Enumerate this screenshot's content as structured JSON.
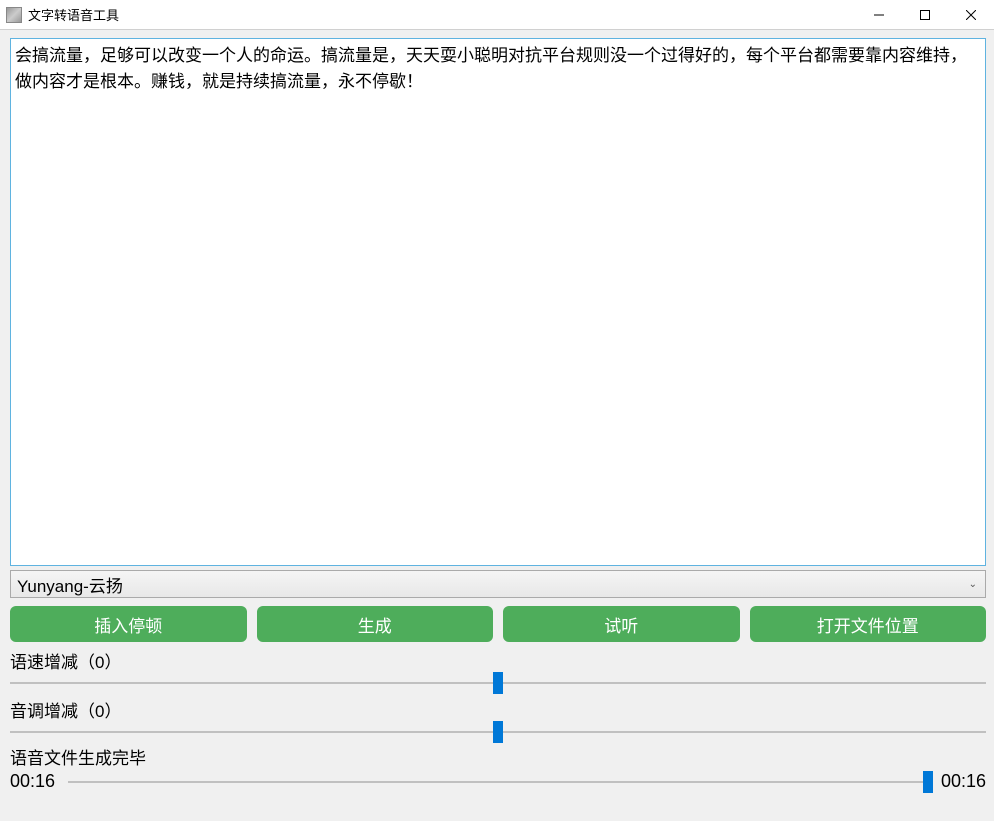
{
  "window": {
    "title": "文字转语音工具"
  },
  "main": {
    "text_content": "会搞流量，足够可以改变一个人的命运。搞流量是，天天耍小聪明对抗平台规则没一个过得好的，每个平台都需要靠内容维持，做内容才是根本。赚钱，就是持续搞流量，永不停歇！",
    "voice_selected": "Yunyang-云扬"
  },
  "buttons": {
    "insert_pause": "插入停顿",
    "generate": "生成",
    "preview": "试听",
    "open_folder": "打开文件位置"
  },
  "sliders": {
    "speed": {
      "label_prefix": "语速增减",
      "value": 0,
      "display": "语速增减（0）",
      "position_percent": 50
    },
    "pitch": {
      "label_prefix": "音调增减",
      "value": 0,
      "display": "音调增减（0）",
      "position_percent": 50
    }
  },
  "status": {
    "message": "语音文件生成完毕"
  },
  "playback": {
    "current_time": "00:16",
    "total_time": "00:16",
    "position_percent": 100
  },
  "colors": {
    "accent_green": "#4ead5b",
    "accent_blue": "#0078d7",
    "textarea_border": "#5fb3e0"
  }
}
